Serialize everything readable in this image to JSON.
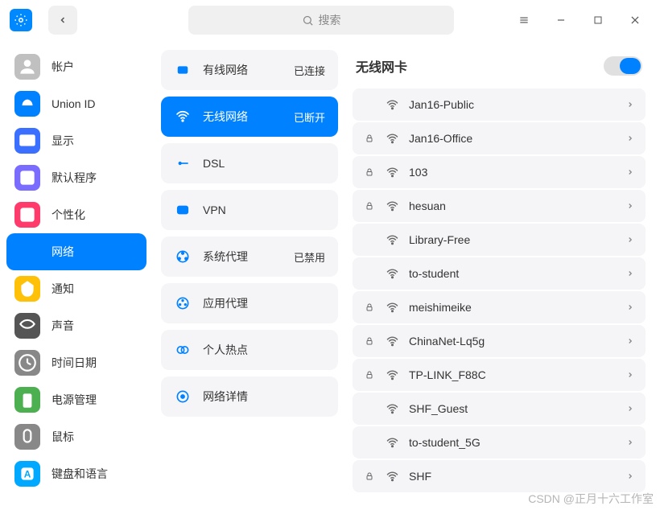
{
  "search": {
    "placeholder": "搜索"
  },
  "sidebar": {
    "items": [
      {
        "label": "帐户",
        "active": false,
        "icon_bg": "#c0c0c0"
      },
      {
        "label": "Union ID",
        "active": false,
        "icon_bg": "#0081ff"
      },
      {
        "label": "显示",
        "active": false,
        "icon_bg": "#3b6fff"
      },
      {
        "label": "默认程序",
        "active": false,
        "icon_bg": "#7a6cff"
      },
      {
        "label": "个性化",
        "active": false,
        "icon_bg": "#ff3b6b"
      },
      {
        "label": "网络",
        "active": true,
        "icon_bg": "#ffffff"
      },
      {
        "label": "通知",
        "active": false,
        "icon_bg": "#ffc107"
      },
      {
        "label": "声音",
        "active": false,
        "icon_bg": "#555"
      },
      {
        "label": "时间日期",
        "active": false,
        "icon_bg": "#888"
      },
      {
        "label": "电源管理",
        "active": false,
        "icon_bg": "#4caf50"
      },
      {
        "label": "鼠标",
        "active": false,
        "icon_bg": "#888"
      },
      {
        "label": "键盘和语言",
        "active": false,
        "icon_bg": "#00a8ff"
      }
    ]
  },
  "categories": [
    {
      "label": "有线网络",
      "status": "已连接",
      "active": false,
      "color": "#0081ff"
    },
    {
      "label": "无线网络",
      "status": "已断开",
      "active": true,
      "color": "#fff"
    },
    {
      "label": "DSL",
      "status": "",
      "active": false,
      "color": "#0081ff"
    },
    {
      "label": "VPN",
      "status": "",
      "active": false,
      "color": "#0081ff"
    },
    {
      "label": "系统代理",
      "status": "已禁用",
      "active": false,
      "color": "#0081ff"
    },
    {
      "label": "应用代理",
      "status": "",
      "active": false,
      "color": "#0081ff"
    },
    {
      "label": "个人热点",
      "status": "",
      "active": false,
      "color": "#0081ff"
    },
    {
      "label": "网络详情",
      "status": "",
      "active": false,
      "color": "#0081ff"
    }
  ],
  "detail": {
    "title": "无线网卡",
    "toggle_on": true,
    "networks": [
      {
        "name": "Jan16-Public",
        "locked": false
      },
      {
        "name": "Jan16-Office",
        "locked": true
      },
      {
        "name": "103",
        "locked": true
      },
      {
        "name": "hesuan",
        "locked": true
      },
      {
        "name": "Library-Free",
        "locked": false
      },
      {
        "name": "to-student",
        "locked": false
      },
      {
        "name": "meishimeike",
        "locked": true
      },
      {
        "name": "ChinaNet-Lq5g",
        "locked": true
      },
      {
        "name": "TP-LINK_F88C",
        "locked": true
      },
      {
        "name": "SHF_Guest",
        "locked": false
      },
      {
        "name": "to-student_5G",
        "locked": false
      },
      {
        "name": "SHF",
        "locked": true
      }
    ]
  },
  "watermark": "CSDN @正月十六工作室"
}
